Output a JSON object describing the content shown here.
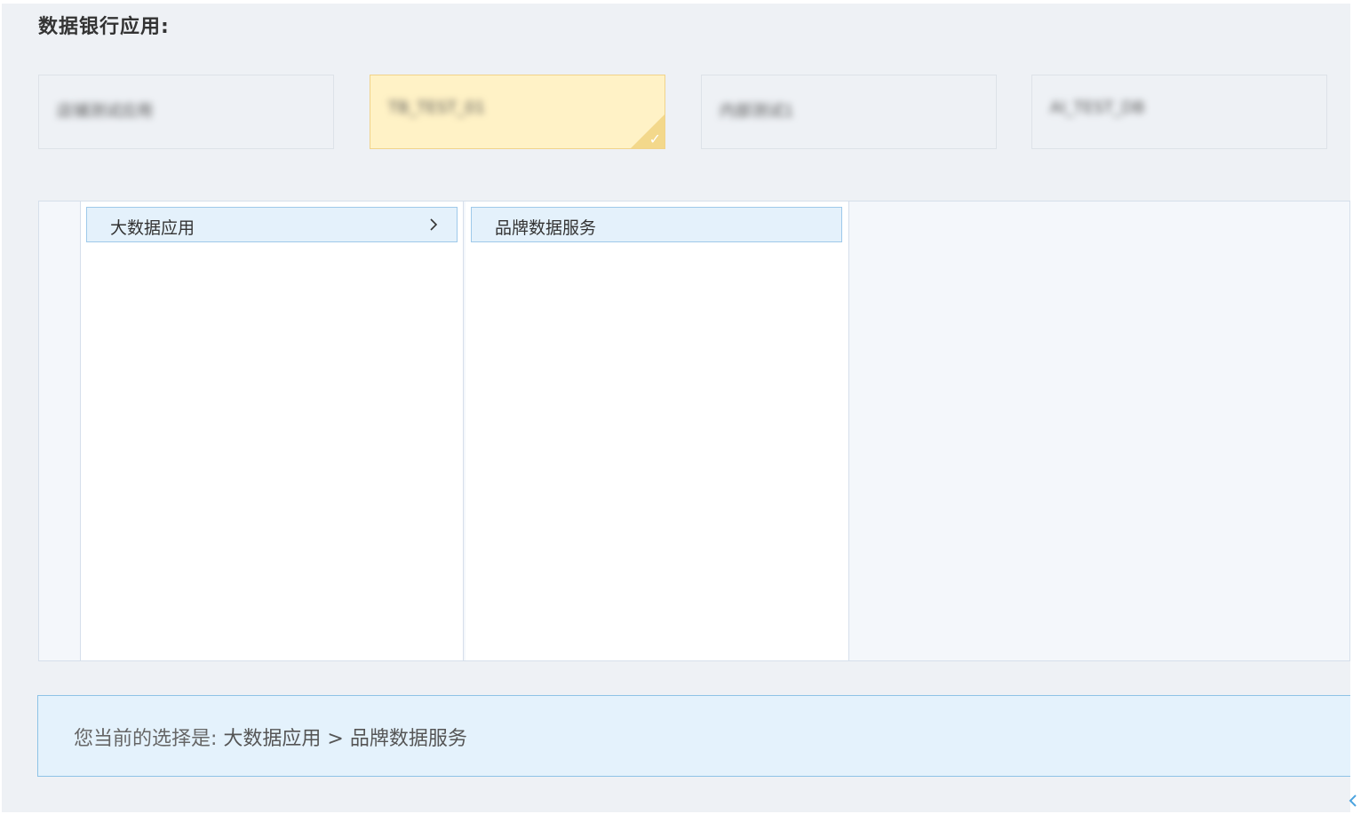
{
  "section_title": "数据银行应用:",
  "cards": [
    {
      "label": "店铺测试应用",
      "selected": false
    },
    {
      "label": "TB_TEST_01",
      "selected": true
    },
    {
      "label": "内部测试1",
      "selected": false
    },
    {
      "label": "AI_TEST_DB",
      "selected": false
    }
  ],
  "cascader": {
    "level1": {
      "label": "大数据应用",
      "has_children": true
    },
    "level2": {
      "label": "品牌数据服务"
    }
  },
  "summary": {
    "prefix": "您当前的选择是:",
    "path": "大数据应用 > 品牌数据服务"
  },
  "colors": {
    "selected_card_bg": "#fff2c6",
    "accent_blue": "#4aa3df",
    "option_bg": "#e4f1fb"
  }
}
